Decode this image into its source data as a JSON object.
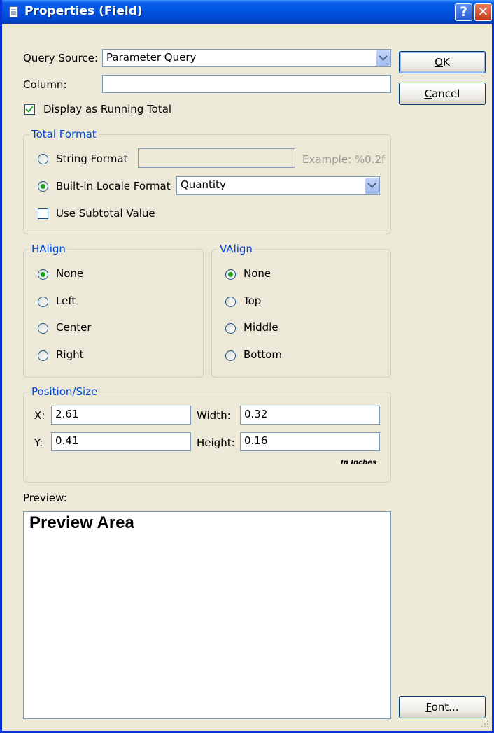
{
  "window": {
    "title": "Properties (Field)",
    "help_glyph": "?",
    "close_glyph": "✕"
  },
  "query_source": {
    "label": "Query Source:",
    "value": "Parameter Query"
  },
  "column": {
    "label": "Column:",
    "value": ""
  },
  "running_total": {
    "label": "Display as Running Total",
    "checked": true
  },
  "buttons": {
    "ok_u": "O",
    "ok_rest": "K",
    "cancel_u": "C",
    "cancel_rest": "ancel",
    "font_u": "F",
    "font_rest": "ont..."
  },
  "total_format": {
    "title": "Total Format",
    "string_format_label": "String Format",
    "string_format_value": "",
    "example": "Example: %0.2f",
    "builtin_label": "Built-in Locale Format",
    "builtin_value": "Quantity",
    "subtotal_label": "Use Subtotal Value",
    "selected": "builtin"
  },
  "halign": {
    "title": "HAlign",
    "options": [
      "None",
      "Left",
      "Center",
      "Right"
    ],
    "selected": "None"
  },
  "valign": {
    "title": "VAlign",
    "options": [
      "None",
      "Top",
      "Middle",
      "Bottom"
    ],
    "selected": "None"
  },
  "position": {
    "title": "Position/Size",
    "x_label": "X:",
    "x_value": "2.61",
    "y_label": "Y:",
    "y_value": "0.41",
    "width_label": "Width:",
    "width_value": "0.32",
    "height_label": "Height:",
    "height_value": "0.16",
    "units": "In Inches"
  },
  "preview": {
    "label": "Preview:",
    "text": "Preview Area"
  },
  "colors": {
    "titlebar": "#0054e3",
    "group_title": "#0046d5",
    "face": "#ece9d8"
  }
}
